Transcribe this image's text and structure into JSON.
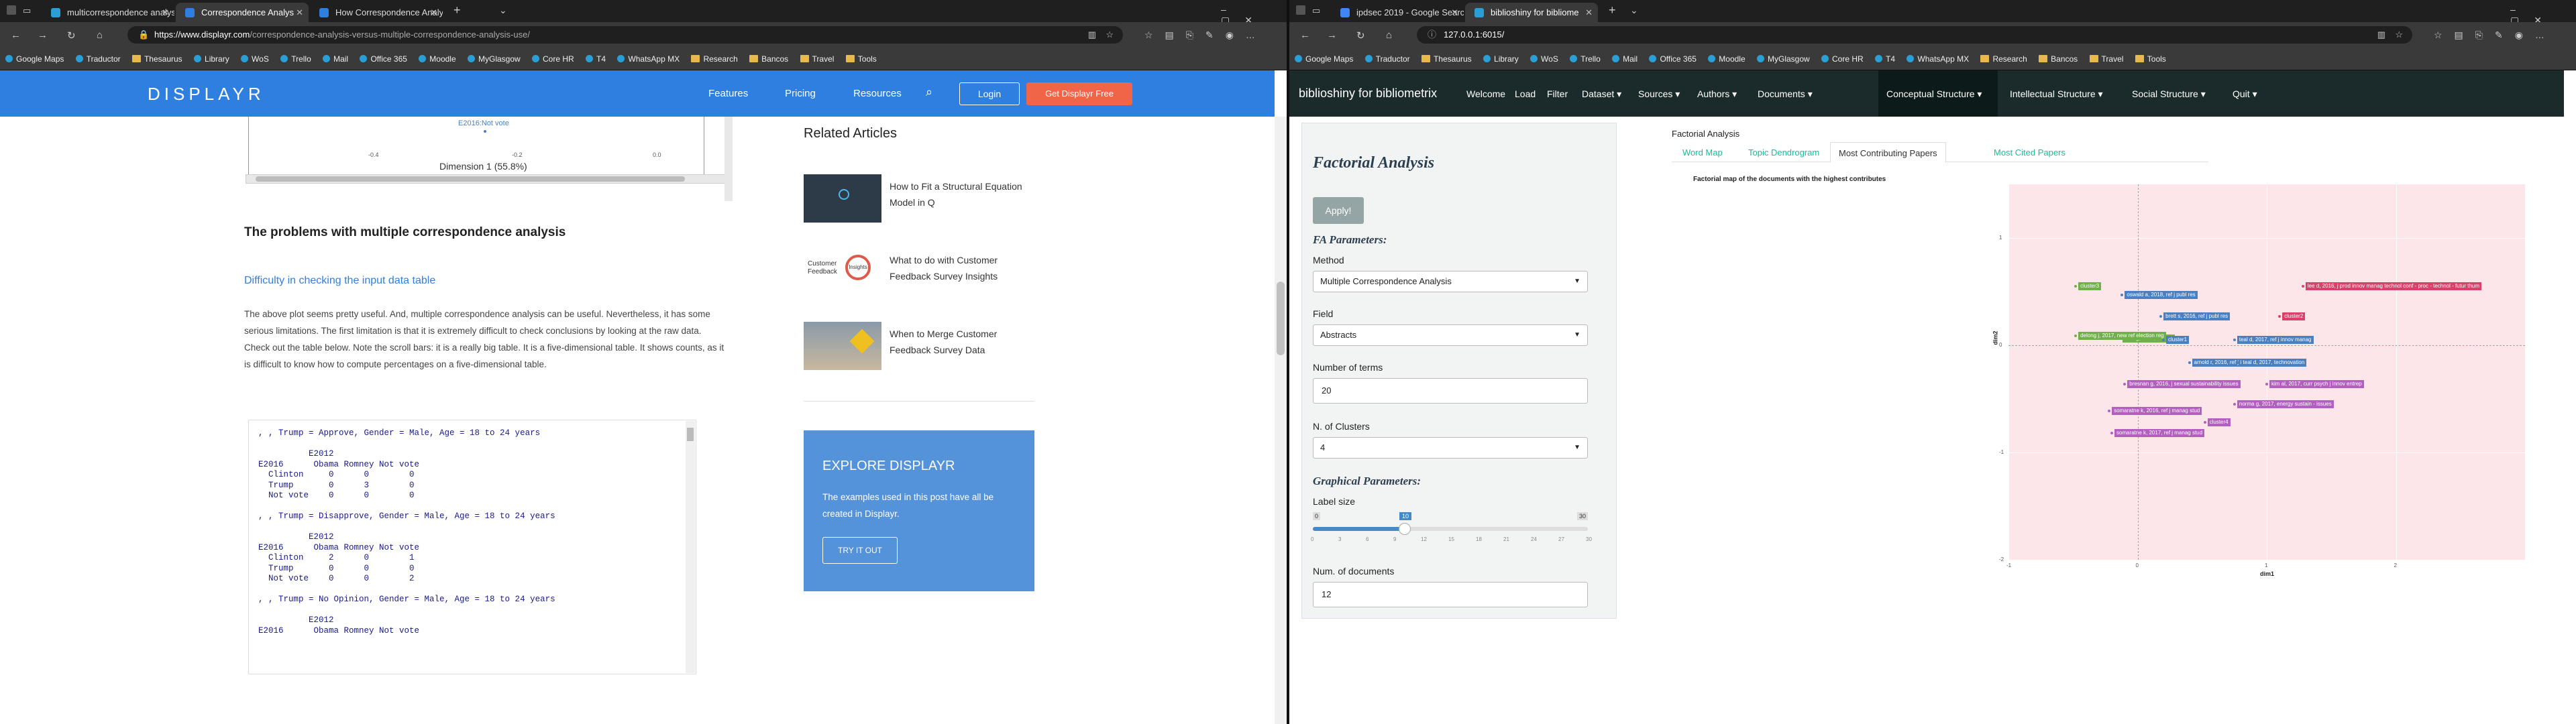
{
  "left_window": {
    "tabs": [
      {
        "title": "multicorrespondence analysi",
        "active": false,
        "favicon": "#2a9fd6"
      },
      {
        "title": "Correspondence Analys",
        "active": true,
        "favicon": "#2e7fe0"
      },
      {
        "title": "How Correspondence Analy",
        "active": false,
        "favicon": "#2e7fe0"
      }
    ],
    "new_tab": "+",
    "url_host": "https://www.displayr.com",
    "url_path": "/correspondence-analysis-versus-multiple-correspondence-analysis-use/",
    "bookmarks": [
      "Google Maps",
      "Traductor",
      "Thesaurus",
      "Library",
      "WoS",
      "Trello",
      "Mail",
      "Office 365",
      "Moodle",
      "MyGlasgow",
      "Core HR",
      "T4",
      "WhatsApp MX",
      "Research",
      "Bancos",
      "Travel",
      "Tools"
    ],
    "site": {
      "logo": "DISPLAYR",
      "nav": [
        "Features",
        "Pricing",
        "Resources"
      ],
      "login": "Login",
      "cta": "Get Displayr Free",
      "accent": "#2e7fe0",
      "cta_color": "#f06447"
    },
    "article": {
      "plot_point_label": "E2016:Not vote",
      "plot_ticks": [
        "-0.4",
        "-0.2",
        "0.0"
      ],
      "plot_xlabel": "Dimension 1 (55.8%)",
      "heading": "The problems with multiple correspondence analysis",
      "subheading": "Difficulty in checking the input data table",
      "paragraph": "The above plot seems pretty useful. And, multiple correspondence analysis can be useful. Nevertheless, it has some serious limitations. The first limitation is that it is extremely difficult to check conclusions by looking at the raw data. Check out the table below. Note the scroll bars: it is a really big table. It is a five-dimensional table. It shows counts, as it is difficult to know how to compute percentages on a five-dimensional table.",
      "code": ", , Trump = Approve, Gender = Male, Age = 18 to 24 years\n\n          E2012\nE2016      Obama Romney Not vote\n  Clinton     0      0        0\n  Trump       0      3        0\n  Not vote    0      0        0\n\n, , Trump = Disapprove, Gender = Male, Age = 18 to 24 years\n\n          E2012\nE2016      Obama Romney Not vote\n  Clinton     2      0        1\n  Trump       0      0        0\n  Not vote    0      0        2\n\n, , Trump = No Opinion, Gender = Male, Age = 18 to 24 years\n\n          E2012\nE2016      Obama Romney Not vote"
    },
    "related": {
      "title": "Related Articles",
      "items": [
        "How to Fit a Structural Equation Model in Q",
        "What to do with Customer Feedback Survey Insights",
        "When to Merge Customer Feedback Survey Data"
      ],
      "thumb2_text": "Customer Feedback",
      "thumb2_badge": "Insights"
    },
    "explore": {
      "title": "EXPLORE DISPLAYR",
      "text": "The examples used in this post have all be created in Displayr.",
      "button": "TRY IT OUT"
    }
  },
  "right_window": {
    "tabs": [
      {
        "title": "ipdsec 2019 - Google Search",
        "active": false,
        "favicon": "#4285f4"
      },
      {
        "title": "biblioshiny for bibliome",
        "active": true,
        "favicon": "#2a9fd6"
      }
    ],
    "new_tab": "+",
    "url": "127.0.0.1:6015/",
    "bookmarks": [
      "Google Maps",
      "Traductor",
      "Thesaurus",
      "Library",
      "WoS",
      "Trello",
      "Mail",
      "Office 365",
      "Moodle",
      "MyGlasgow",
      "Core HR",
      "T4",
      "WhatsApp MX",
      "Research",
      "Bancos",
      "Travel",
      "Tools"
    ],
    "navbar": {
      "brand": "biblioshiny for bibliometrix",
      "items": [
        "Welcome",
        "Load",
        "Filter",
        "Dataset ▾",
        "Sources ▾",
        "Authors ▾",
        "Documents ▾",
        "Conceptual Structure ▾",
        "Intellectual Structure ▾",
        "Social Structure ▾",
        "Quit ▾"
      ],
      "active": "Conceptual Structure ▾"
    },
    "sidebar": {
      "title": "Factorial Analysis",
      "apply": "Apply!",
      "fa_params": "FA Parameters:",
      "method_label": "Method",
      "method_value": "Multiple Correspondence Analysis",
      "field_label": "Field",
      "field_value": "Abstracts",
      "terms_label": "Number of terms",
      "terms_value": "20",
      "clusters_label": "N. of Clusters",
      "clusters_value": "4",
      "graph_params": "Graphical Parameters:",
      "label_size_label": "Label size",
      "slider_min": "0",
      "slider_max": "30",
      "slider_value": "10",
      "slider_fraction": 0.333,
      "slider_ticks": [
        "0",
        "3",
        "6",
        "9",
        "12",
        "15",
        "18",
        "21",
        "24",
        "27",
        "30"
      ],
      "numdocs_label": "Num. of documents",
      "numdocs_value": "12"
    },
    "main": {
      "section_title": "Factorial Analysis",
      "tabs": [
        "Word Map",
        "Topic Dendrogram",
        "Most Contributing Papers",
        "Most Cited Papers"
      ],
      "active_tab": "Most Contributing Papers"
    }
  },
  "chart_data": {
    "type": "scatter",
    "title": "Factorial map of the documents with the highest contributes",
    "xlabel": "dim1",
    "ylabel": "dim2",
    "xlim": [
      -1,
      3
    ],
    "ylim": [
      -2,
      1.5
    ],
    "xticks": [
      "-1",
      "0",
      "1",
      "2"
    ],
    "yticks": [
      "1",
      "0",
      "-1",
      "-2"
    ],
    "background": "#fde6ea",
    "series": [
      {
        "color": "#6fb04a",
        "points": [
          {
            "x": -0.48,
            "y": 0.55,
            "label": "cluster3"
          },
          {
            "x": -0.14,
            "y": 0.06,
            "label": "ortiz g, 2017, bmc ..."
          },
          {
            "x": -0.48,
            "y": 0.09,
            "label": "delong j, 2017, new ref election reg"
          }
        ]
      },
      {
        "color": "#4a7fc0",
        "points": [
          {
            "x": -0.12,
            "y": 0.47,
            "label": "oswald a, 2018, ref j publ res"
          },
          {
            "x": 0.18,
            "y": 0.27,
            "label": "brett s, 2016, ref j publ res"
          },
          {
            "x": 0.2,
            "y": 0.05,
            "label": "cluster1"
          },
          {
            "x": 0.75,
            "y": 0.05,
            "label": "teal d, 2017, ref j innov manag"
          },
          {
            "x": 0.4,
            "y": -0.16,
            "label": "arnold r, 2016, ref j innov manage"
          },
          {
            "x": 0.78,
            "y": -0.16,
            "label": "teal d, 2017, technovation"
          }
        ]
      },
      {
        "color": "#d9416b",
        "points": [
          {
            "x": 1.28,
            "y": 0.55,
            "label": "lee d, 2016, j prod innov manag technol conf - proc - technol - futur thum"
          },
          {
            "x": 1.1,
            "y": 0.27,
            "label": "cluster2"
          }
        ]
      },
      {
        "color": "#b25fc0",
        "points": [
          {
            "x": -0.1,
            "y": -0.36,
            "label": "bresnan g, 2016, j sexual sustainability issues"
          },
          {
            "x": 1.0,
            "y": -0.36,
            "label": "kim al, 2017, curr psych j innov entrep"
          },
          {
            "x": 0.75,
            "y": -0.55,
            "label": "norma g, 2017, energy sustain - issues"
          },
          {
            "x": -0.22,
            "y": -0.61,
            "label": "somaratne k, 2016, ref j manag stud"
          },
          {
            "x": 0.52,
            "y": -0.72,
            "label": "cluster4"
          },
          {
            "x": -0.2,
            "y": -0.82,
            "label": "somaratne k, 2017, ref j manag stud"
          }
        ]
      }
    ]
  }
}
